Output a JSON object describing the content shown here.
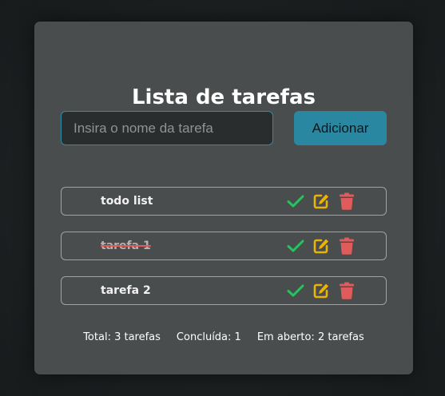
{
  "app": {
    "title": "Lista de tarefas"
  },
  "form": {
    "input_value": "",
    "input_placeholder": "Insira o nome da tarefa",
    "add_label": "Adicionar"
  },
  "tasks": [
    {
      "label": "todo list",
      "completed": false
    },
    {
      "label": "tarefa 1",
      "completed": true
    },
    {
      "label": "tarefa 2",
      "completed": false
    }
  ],
  "icons": {
    "complete": "check-icon",
    "edit": "edit-icon",
    "delete": "trash-icon"
  },
  "colors": {
    "accent": "#2a87a1",
    "check": "#22c55e",
    "edit": "#eab308",
    "delete": "#e05c5c"
  },
  "footer": {
    "total": "Total: 3 tarefas",
    "completed": "Concluída: 1",
    "open": "Em aberto: 2 tarefas"
  }
}
